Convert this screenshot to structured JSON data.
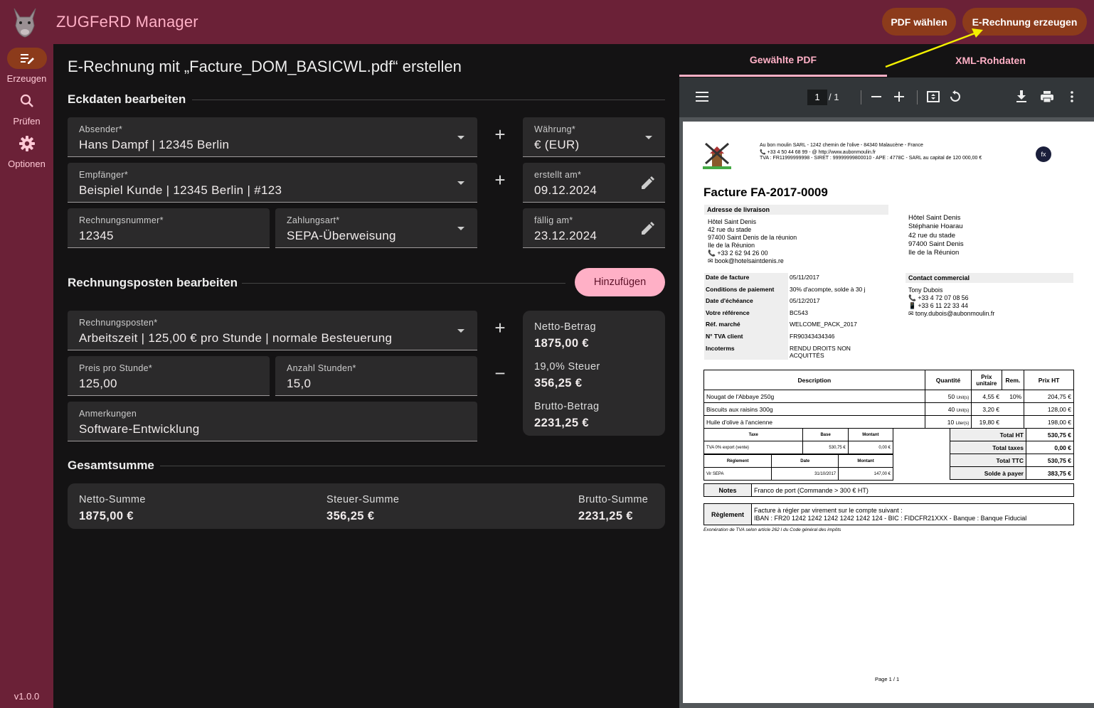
{
  "app": {
    "title": "ZUGFeRD Manager",
    "version": "v1.0.0"
  },
  "top_buttons": {
    "pdf": "PDF wählen",
    "erzeugen": "E-Rechnung erzeugen"
  },
  "rail": [
    {
      "label": "Erzeugen",
      "icon": "edit-list-icon"
    },
    {
      "label": "Prüfen",
      "icon": "search-icon"
    },
    {
      "label": "Optionen",
      "icon": "gear-icon"
    }
  ],
  "main": {
    "heading": "E-Rechnung mit „Facture_DOM_BASICWL.pdf“ erstellen",
    "sec1": "Eckdaten bearbeiten",
    "absender": {
      "label": "Absender*",
      "value": "Hans Dampf | 12345 Berlin"
    },
    "waehrung": {
      "label": "Währung*",
      "value": "€ (EUR)"
    },
    "empfaenger": {
      "label": "Empfänger*",
      "value": "Beispiel Kunde | 12345 Berlin | #123"
    },
    "erstellt": {
      "label": "erstellt am*",
      "value": "09.12.2024"
    },
    "rechnungsnr": {
      "label": "Rechnungsnummer*",
      "value": "12345"
    },
    "zahlungsart": {
      "label": "Zahlungsart*",
      "value": "SEPA-Überweisung"
    },
    "faellig": {
      "label": "fällig am*",
      "value": "23.12.2024"
    },
    "sec2": "Rechnungsposten bearbeiten",
    "add": "Hinzufügen",
    "posten": {
      "label": "Rechnungsposten*",
      "value": "Arbeitszeit | 125,00 € pro Stunde | normale Besteuerung"
    },
    "preis": {
      "label": "Preis pro Stunde*",
      "value": "125,00"
    },
    "stunden": {
      "label": "Anzahl Stunden*",
      "value": "15,0"
    },
    "anmerk": {
      "label": "Anmerkungen",
      "value": "Software-Entwicklung"
    },
    "box": {
      "netto_l": "Netto-Betrag",
      "netto": "1875,00 €",
      "steuer_l": "19,0% Steuer",
      "steuer": "356,25 €",
      "brutto_l": "Brutto-Betrag",
      "brutto": "2231,25 €"
    },
    "sec3": "Gesamtsumme",
    "total": {
      "netto_l": "Netto-Summe",
      "netto": "1875,00 €",
      "steuer_l": "Steuer-Summe",
      "steuer": "356,25 €",
      "brutto_l": "Brutto-Summe",
      "brutto": "2231,25 €"
    }
  },
  "tabs": [
    "Gewählte PDF",
    "XML-Rohdaten"
  ],
  "pdf": {
    "page": "1",
    "pages": "/ 1",
    "company": "Au bon moulin SARL - 1242 chemin de l'olive - 84340 Malaucène - France",
    "contact": "📞 +33 4 50 44 68 99 - @ http://www.aubonmoulin.fr",
    "tva": "TVA : FR11999999998 - SIRET : 99999999800010 - APE : 4778C - SARL au capital de 120 000,00 €",
    "title": "Facture FA-2017-0009",
    "livraison_h": "Adresse de livraison",
    "livraison": [
      "Hôtel Saint Denis",
      "42 rue du stade",
      "97400 Saint Denis de la réunion",
      "Ile de la Réunion",
      "📞 +33 2 62 94 26 00",
      "✉ book@hotelsaintdenis.re"
    ],
    "client": [
      "Hôtel Saint Denis",
      "Stéphanie Hoarau",
      "42 rue du stade",
      "97400 Saint Denis",
      "Ile de la Réunion"
    ],
    "meta": [
      [
        "Date de facture",
        "05/11/2017"
      ],
      [
        "Conditions de paiement",
        "30% d'acompte, solde à 30 j"
      ],
      [
        "Date d'échéance",
        "05/12/2017"
      ],
      [
        "Votre référence",
        "BC543"
      ],
      [
        "Réf. marché",
        "WELCOME_PACK_2017"
      ],
      [
        "N° TVA client",
        "FR90343434346"
      ],
      [
        "Incoterms",
        "RENDU DROITS NON ACQUITTÉS"
      ]
    ],
    "contact_h": "Contact commercial",
    "contact_lines": [
      "Tony Dubois",
      "📞 +33 4 72 07 08 56",
      "📱 +33 6 11 22 33 44",
      "✉ tony.dubois@aubonmoulin.fr"
    ],
    "cols": [
      "Description",
      "Quantité",
      "Prix unitaire",
      "Rem.",
      "Prix HT"
    ],
    "rows": [
      [
        "Nougat de l'Abbaye 250g",
        "50",
        "Unit(s)",
        "4,55 €",
        "10%",
        "204,75 €"
      ],
      [
        "Biscuits aux raisins 300g",
        "40",
        "Unit(s)",
        "3,20 €",
        "",
        "128,00 €"
      ],
      [
        "Huile d'olive à l'ancienne",
        "10",
        "Liter(s)",
        "19,80 €",
        "",
        "198,00 €"
      ]
    ],
    "tax_cols": [
      "Taxe",
      "Base",
      "Montant"
    ],
    "tax_row": [
      "TVA 0% export (vente)",
      "530,75 €",
      "0,00 €"
    ],
    "reg_cols": [
      "Règlement",
      "Date",
      "Montant"
    ],
    "reg_row": [
      "Vir SEPA",
      "31/10/2017",
      "147,00 €"
    ],
    "totals": [
      [
        "Total HT",
        "530,75 €"
      ],
      [
        "Total taxes",
        "0,00 €"
      ],
      [
        "Total TTC",
        "530,75 €"
      ],
      [
        "Solde à payer",
        "383,75 €"
      ]
    ],
    "notes_l": "Notes",
    "notes": "Franco de port (Commande > 300 € HT)",
    "reglement_l": "Règlement",
    "reglement1": "Facture à régler par virement sur le compte suivant :",
    "reglement2": "IBAN : FR20 1242 1242 1242 1242 1242 124 - BIC : FIDCFR21XXX - Banque : Banque Fiducial",
    "exo": "Exonération de TVA selon article 262 I du Code général des impôts",
    "footer": "Page 1 / 1"
  }
}
